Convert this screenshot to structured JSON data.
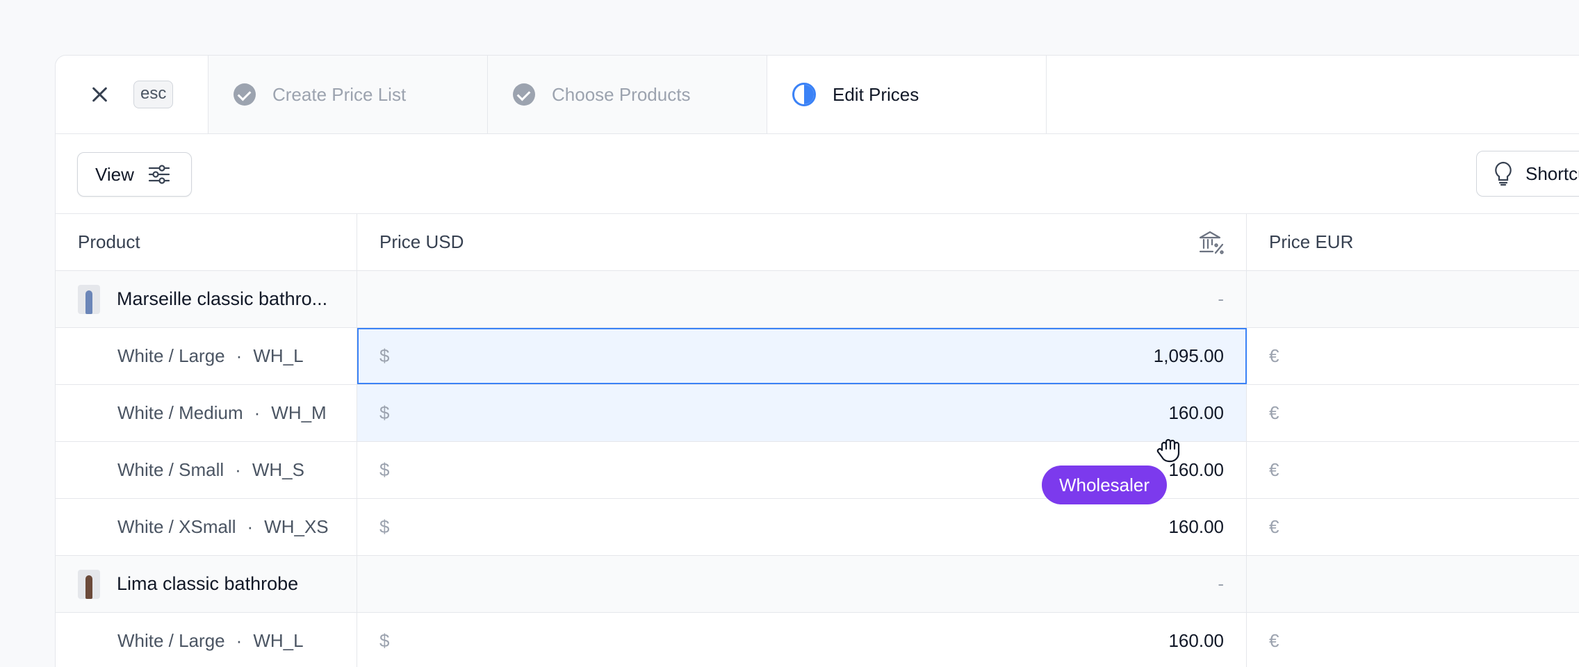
{
  "stepper": {
    "esc_label": "esc",
    "steps": [
      {
        "label": "Create Price List",
        "state": "done"
      },
      {
        "label": "Choose Products",
        "state": "done"
      },
      {
        "label": "Edit Prices",
        "state": "active"
      }
    ]
  },
  "toolbar": {
    "view_label": "View",
    "shortcuts_label": "Shortcuts"
  },
  "table": {
    "columns": [
      "Product",
      "Price USD",
      "Price EUR"
    ],
    "usd_symbol": "$",
    "eur_symbol": "€",
    "empty_value": "-",
    "products": [
      {
        "name": "Marseille classic bathro...",
        "variants": [
          {
            "title": "White / Large",
            "sku": "WH_L",
            "usd": "1,095.00"
          },
          {
            "title": "White / Medium",
            "sku": "WH_M",
            "usd": "160.00"
          },
          {
            "title": "White / Small",
            "sku": "WH_S",
            "usd": "160.00"
          },
          {
            "title": "White / XSmall",
            "sku": "WH_XS",
            "usd": "160.00"
          }
        ]
      },
      {
        "name": "Lima classic bathrobe",
        "variants": [
          {
            "title": "White / Large",
            "sku": "WH_L",
            "usd": "160.00"
          }
        ]
      }
    ]
  },
  "tooltip": {
    "label": "Wholesaler"
  },
  "colors": {
    "accent": "#3b82f6",
    "tooltip": "#7c3aed",
    "selection": "#eef5ff"
  }
}
